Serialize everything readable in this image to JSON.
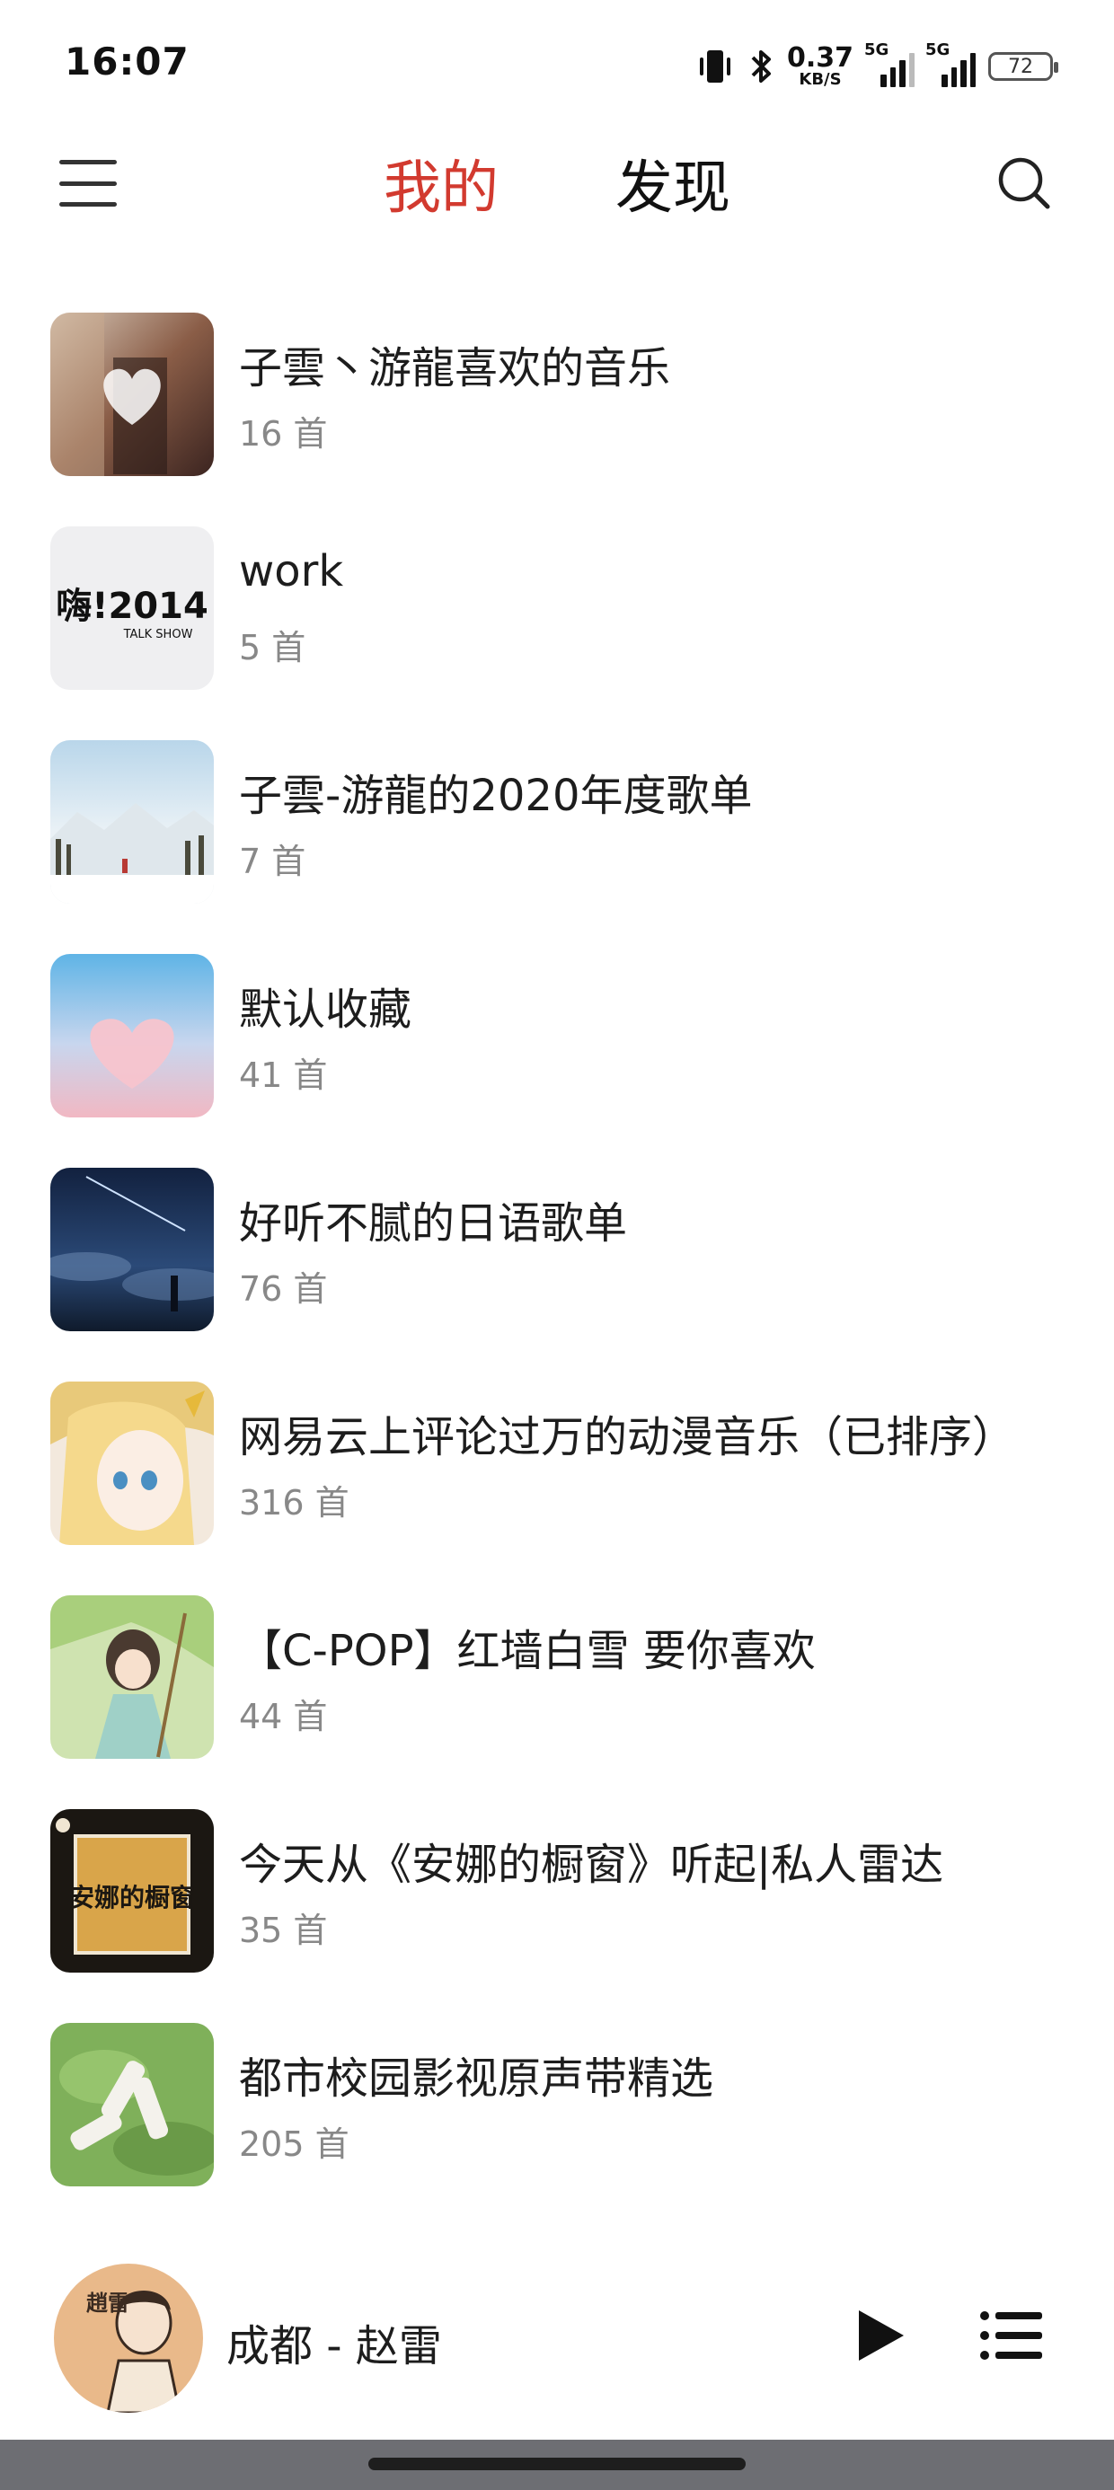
{
  "status_bar": {
    "time": "16:07",
    "net_speed_value": "0.37",
    "net_speed_unit": "KB/S",
    "sim1_tag": "5G",
    "sim2_tag": "5G",
    "battery": "72"
  },
  "header": {
    "tabs": [
      {
        "label": "我的",
        "active": true
      },
      {
        "label": "发现",
        "active": false
      }
    ]
  },
  "playlists": [
    {
      "title": "子雲丶游龍喜欢的音乐",
      "count": "16 首"
    },
    {
      "title": "work",
      "count": "5 首"
    },
    {
      "title": "子雲-游龍的2020年度歌单",
      "count": "7 首"
    },
    {
      "title": "默认收藏",
      "count": "41 首"
    },
    {
      "title": "好听不腻的日语歌单",
      "count": "76 首"
    },
    {
      "title": "网易云上评论过万的动漫音乐（已排序）",
      "count": "316 首"
    },
    {
      "title": "【C-POP】红墙白雪 要你喜欢",
      "count": "44 首"
    },
    {
      "title": "今天从《安娜的橱窗》听起|私人雷达",
      "count": "35 首"
    },
    {
      "title": "都市校园影视原声带精选",
      "count": "205 首"
    }
  ],
  "covers": {
    "work_text": "嗨!2014",
    "work_subtext": "TALK SHOW",
    "anna_text": "安娜的橱窗",
    "avatar_text": "趙雷"
  },
  "player": {
    "now_playing": "成都 - 赵雷"
  },
  "colors": {
    "accent": "#d23a2f"
  }
}
